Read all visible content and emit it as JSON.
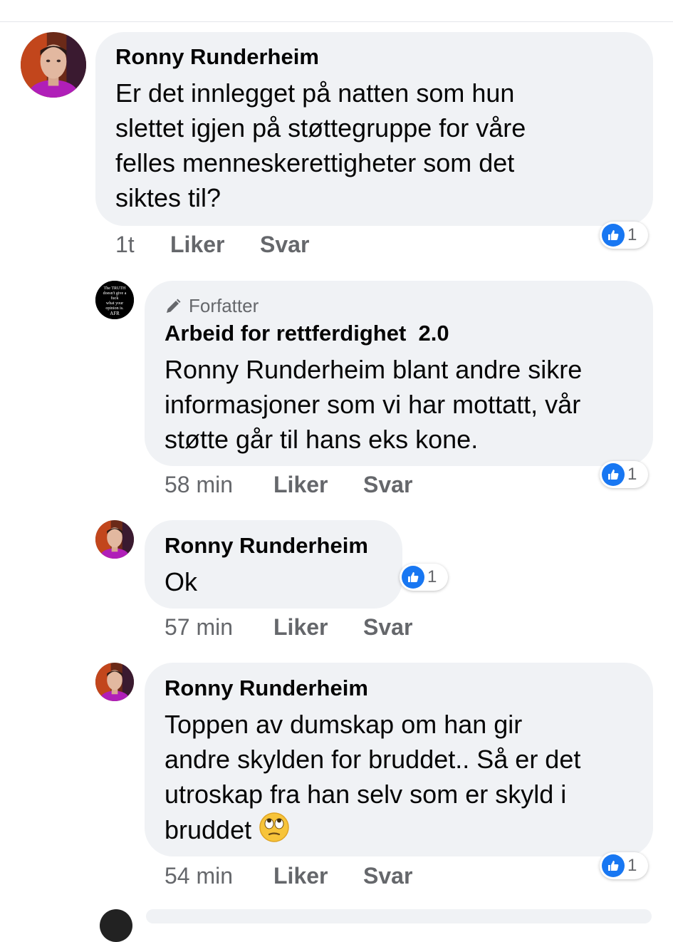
{
  "comments": [
    {
      "author": "Ronny Runderheim",
      "text_lines": [
        "Er det innlegget på natten som hun",
        "slettet igjen på støttegruppe for våre",
        "felles menneskerettigheter som det",
        "siktes til?"
      ],
      "time": "1t",
      "like_label": "Liker",
      "reply_label": "Svar",
      "reaction_count": "1",
      "reaction_icon": "thumbs-up-icon"
    },
    {
      "author_badge": "Forfatter",
      "author": "Arbeid for rettferdighet  2.0",
      "avatar_text": [
        "The TRUTH",
        "doesn't give a",
        "fuck",
        "what your",
        "opinion is.",
        "AFR"
      ],
      "text_lines": [
        "Ronny Runderheim blant andre sikre",
        "informasjoner som vi har mottatt, vår",
        "støtte går til hans eks kone."
      ],
      "time": "58 min",
      "like_label": "Liker",
      "reply_label": "Svar",
      "reaction_count": "1",
      "reaction_icon": "thumbs-up-icon"
    },
    {
      "author": "Ronny Runderheim",
      "text_lines": [
        "Ok"
      ],
      "time": "57 min",
      "like_label": "Liker",
      "reply_label": "Svar",
      "reaction_count": "1",
      "reaction_icon": "thumbs-up-icon"
    },
    {
      "author": "Ronny Runderheim",
      "text_lines": [
        "Toppen av dumskap om han gir",
        "andre skylden for bruddet.. Så er det",
        "utroskap fra han selv som er skyld i",
        "bruddet"
      ],
      "emoji": "face-with-rolling-eyes-icon",
      "time": "54 min",
      "like_label": "Liker",
      "reply_label": "Svar",
      "reaction_count": "1",
      "reaction_icon": "thumbs-up-icon"
    }
  ],
  "colors": {
    "bubble": "#f0f2f5",
    "meta_text": "#65676b",
    "like_blue": "#1877f2",
    "avatar_purple": "#b01fb8"
  }
}
